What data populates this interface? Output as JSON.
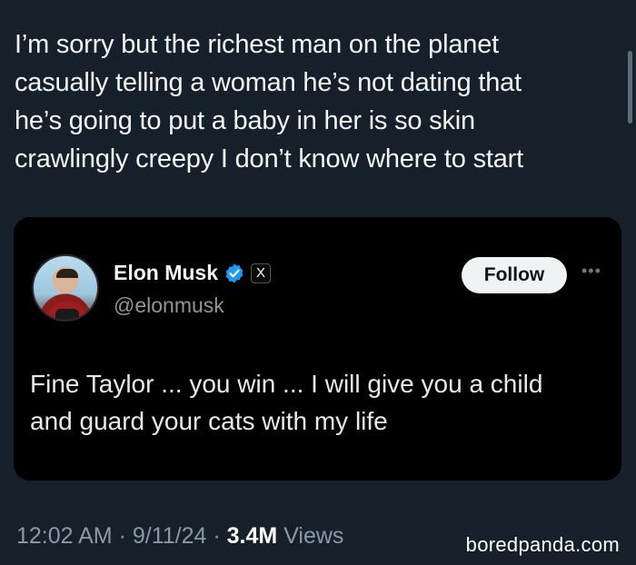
{
  "post": {
    "lines": [
      "I’m sorry but the richest man on the planet",
      "casually telling a woman he’s not dating that",
      "he’s going to put a baby in her is so skin",
      "crawlingly creepy I don’t know where to start"
    ]
  },
  "quote": {
    "display_name": "Elon Musk",
    "handle": "@elonmusk",
    "verified_icon": "verified-badge",
    "affiliation_badge": "X",
    "follow_label": "Follow",
    "more_icon": "more-horizontal-icon",
    "lines": [
      "Fine Taylor ... you win ... I will give you a child",
      "and guard your cats with my life"
    ]
  },
  "meta": {
    "time": "12:02 AM",
    "date": "9/11/24",
    "separator": " · ",
    "views_count": "3.4M",
    "views_label": "Views"
  },
  "watermark": "boredpanda.com",
  "colors": {
    "background": "#15202b",
    "card_background": "#000000",
    "verified_blue": "#1d9bf0",
    "muted_text": "#8b98a5"
  }
}
